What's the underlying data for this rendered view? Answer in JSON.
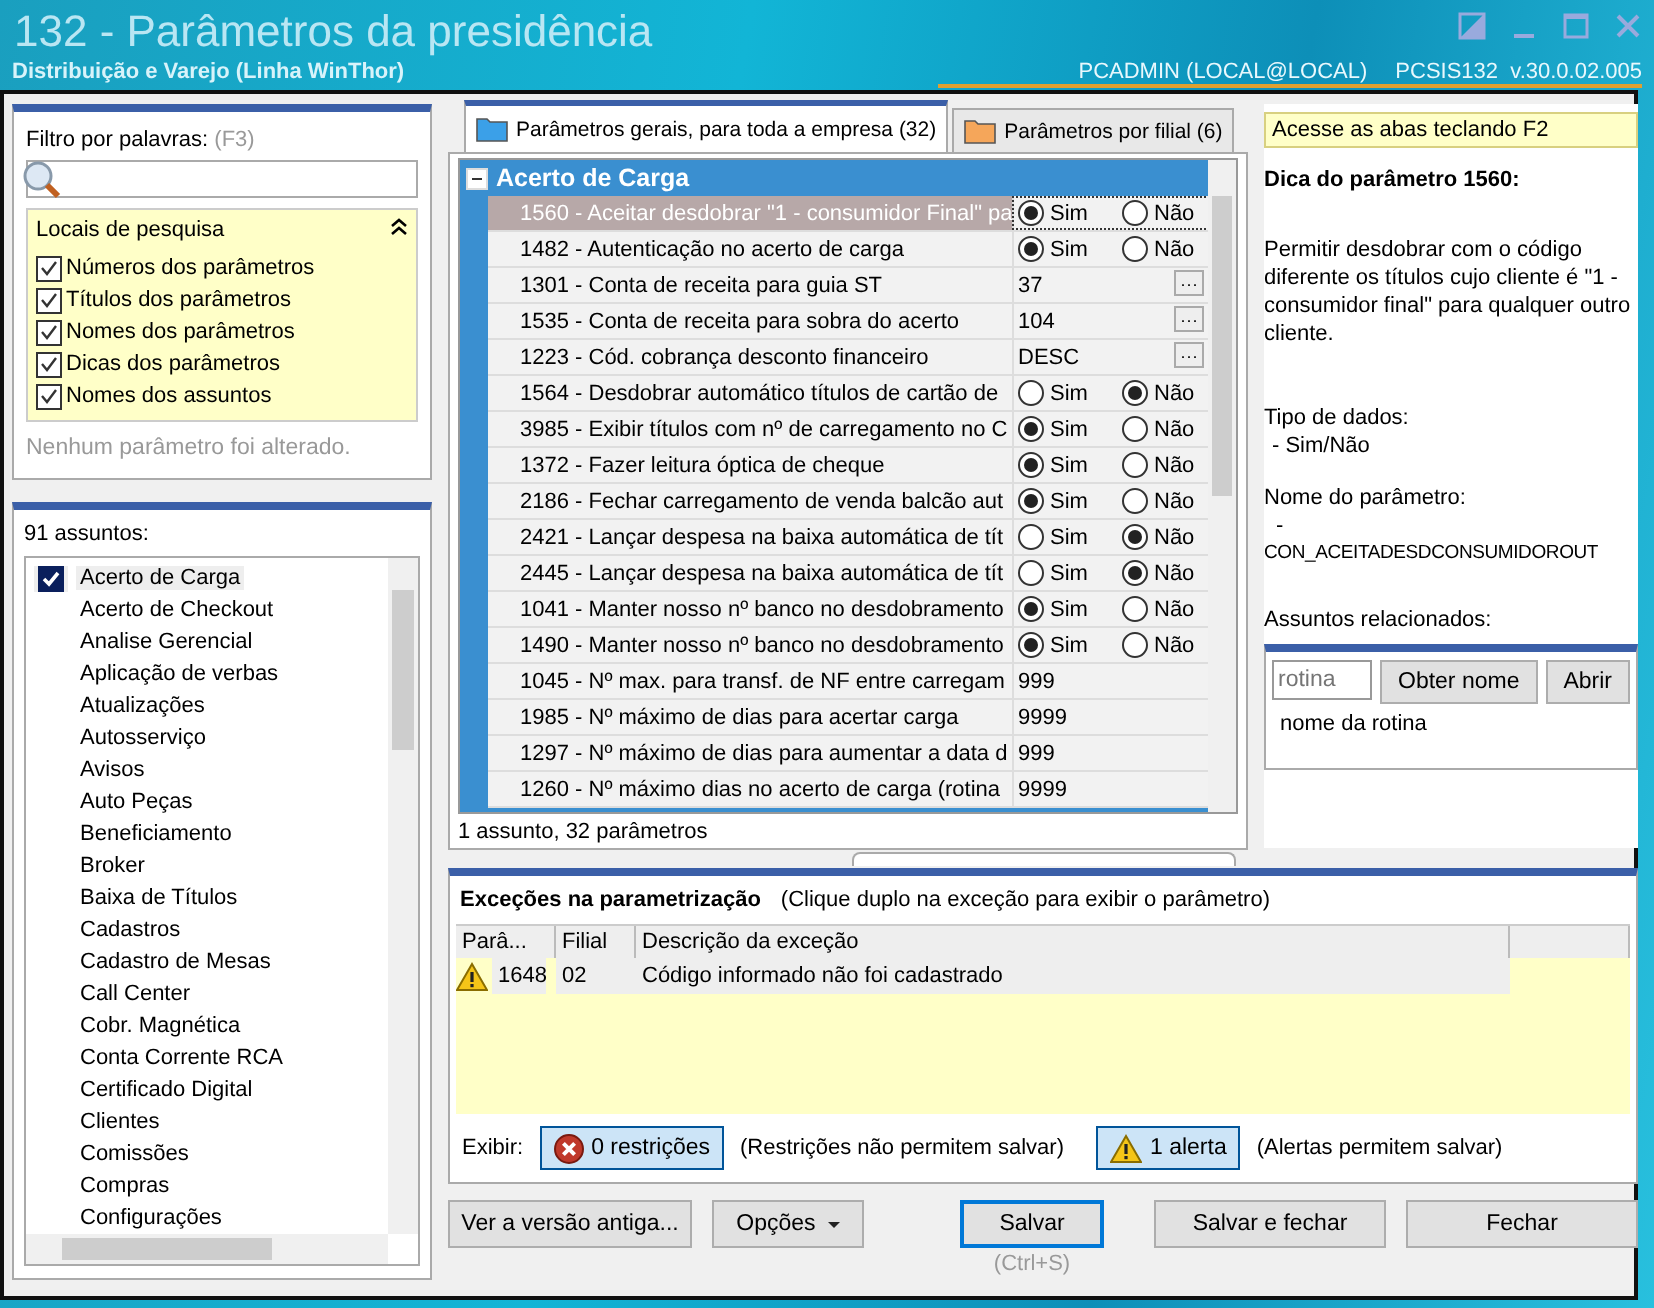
{
  "window": {
    "title": "132 - Parâmetros da presidência",
    "subtitle": "Distribuição e Varejo (Linha WinThor)",
    "user": "PCADMIN (LOCAL@LOCAL)",
    "program": "PCSIS132  v.30.0.02.005"
  },
  "filter": {
    "label": "Filtro por palavras:",
    "shortcut": "(F3)",
    "search_locations": {
      "title": "Locais de pesquisa",
      "expanded": true,
      "options": [
        {
          "label": "Números dos parâmetros",
          "checked": true
        },
        {
          "label": "Títulos dos parâmetros",
          "checked": true
        },
        {
          "label": "Nomes dos parâmetros",
          "checked": true
        },
        {
          "label": "Dicas dos parâmetros",
          "checked": true
        },
        {
          "label": "Nomes dos assuntos",
          "checked": true
        }
      ]
    },
    "status": "Nenhum parâmetro foi alterado."
  },
  "subjects": {
    "count_label": "91 assuntos:",
    "items": [
      {
        "label": "Acerto de Carga",
        "checked": true
      },
      {
        "label": "Acerto de Checkout",
        "checked": false
      },
      {
        "label": "Analise Gerencial",
        "checked": false
      },
      {
        "label": "Aplicação de verbas",
        "checked": false
      },
      {
        "label": "Atualizações",
        "checked": false
      },
      {
        "label": "Autosserviço",
        "checked": false
      },
      {
        "label": "Avisos",
        "checked": false
      },
      {
        "label": "Auto Peças",
        "checked": false
      },
      {
        "label": "Beneficiamento",
        "checked": false
      },
      {
        "label": "Broker",
        "checked": false
      },
      {
        "label": "Baixa de Títulos",
        "checked": false
      },
      {
        "label": "Cadastros",
        "checked": false
      },
      {
        "label": "Cadastro de Mesas",
        "checked": false
      },
      {
        "label": "Call Center",
        "checked": false
      },
      {
        "label": "Cobr. Magnética",
        "checked": false
      },
      {
        "label": "Conta Corrente RCA",
        "checked": false
      },
      {
        "label": "Certificado Digital",
        "checked": false
      },
      {
        "label": "Clientes",
        "checked": false
      },
      {
        "label": "Comissões",
        "checked": false
      },
      {
        "label": "Compras",
        "checked": false
      },
      {
        "label": "Configurações",
        "checked": false
      }
    ]
  },
  "tabs": [
    {
      "label": "Parâmetros gerais, para toda a empresa",
      "count": "(32)",
      "selected": true
    },
    {
      "label": "Parâmetros por filial",
      "count": "(6)",
      "selected": false
    }
  ],
  "grid": {
    "group": "Acerto de Carga",
    "expanded": true,
    "rows": [
      {
        "label": "1560 - Aceitar desdobrar \"1 - consumidor Final\" pa",
        "kind": "choice",
        "selected": true,
        "options": [
          {
            "label": "Sim",
            "selected": true
          },
          {
            "label": "Não",
            "selected": false
          }
        ]
      },
      {
        "label": "1482 - Autenticação no acerto de carga",
        "kind": "choice",
        "selected": false,
        "options": [
          {
            "label": "Sim",
            "selected": true
          },
          {
            "label": "Não",
            "selected": false
          }
        ]
      },
      {
        "label": "1301 - Conta de receita para guia ST",
        "kind": "lookup",
        "selected": false,
        "value": "37",
        "button": "···"
      },
      {
        "label": "1535 - Conta de receita para sobra do acerto",
        "kind": "lookup",
        "selected": false,
        "value": "104",
        "button": "···"
      },
      {
        "label": "1223 - Cód. cobrança desconto financeiro",
        "kind": "lookup",
        "selected": false,
        "value": "DESC",
        "button": "···"
      },
      {
        "label": "1564 - Desdobrar automático títulos de cartão de",
        "kind": "choice",
        "selected": false,
        "options": [
          {
            "label": "Sim",
            "selected": false
          },
          {
            "label": "Não",
            "selected": true
          }
        ]
      },
      {
        "label": "3985 - Exibir títulos com nº de carregamento no C",
        "kind": "choice",
        "selected": false,
        "options": [
          {
            "label": "Sim",
            "selected": true
          },
          {
            "label": "Não",
            "selected": false
          }
        ]
      },
      {
        "label": "1372 - Fazer leitura óptica de cheque",
        "kind": "choice",
        "selected": false,
        "options": [
          {
            "label": "Sim",
            "selected": true
          },
          {
            "label": "Não",
            "selected": false
          }
        ]
      },
      {
        "label": "2186 - Fechar carregamento de venda balcão aut",
        "kind": "choice",
        "selected": false,
        "options": [
          {
            "label": "Sim",
            "selected": true
          },
          {
            "label": "Não",
            "selected": false
          }
        ]
      },
      {
        "label": "2421 - Lançar despesa na baixa automática de tít",
        "kind": "choice",
        "selected": false,
        "options": [
          {
            "label": "Sim",
            "selected": false
          },
          {
            "label": "Não",
            "selected": true
          }
        ]
      },
      {
        "label": "2445 - Lançar despesa na baixa automática de tít",
        "kind": "choice",
        "selected": false,
        "options": [
          {
            "label": "Sim",
            "selected": false
          },
          {
            "label": "Não",
            "selected": true
          }
        ]
      },
      {
        "label": "1041 - Manter nosso nº banco no desdobramento",
        "kind": "choice",
        "selected": false,
        "options": [
          {
            "label": "Sim",
            "selected": true
          },
          {
            "label": "Não",
            "selected": false
          }
        ]
      },
      {
        "label": "1490 - Manter nosso nº banco no desdobramento",
        "kind": "choice",
        "selected": false,
        "options": [
          {
            "label": "Sim",
            "selected": true
          },
          {
            "label": "Não",
            "selected": false
          }
        ]
      },
      {
        "label": "1045 - Nº max. para transf. de NF entre carregam",
        "kind": "text",
        "selected": false,
        "value": "999"
      },
      {
        "label": "1985 - Nº máximo de dias para acertar carga",
        "kind": "text",
        "selected": false,
        "value": "9999"
      },
      {
        "label": "1297 - Nº máximo de dias para aumentar a data d",
        "kind": "text",
        "selected": false,
        "value": "999"
      },
      {
        "label": "1260 - Nº máximo dias no acerto de carga (rotina",
        "kind": "text",
        "selected": false,
        "value": "9999"
      }
    ],
    "footer": "1 assunto, 32 parâmetros"
  },
  "hint": {
    "banner": "Acesse as abas teclando F2",
    "title": "Dica do parâmetro 1560:",
    "description": "Permitir desdobrar com o código diferente os títulos cujo cliente é \"1 - consumidor final\" para qualquer outro cliente.",
    "data_type_label": "Tipo de dados:",
    "data_type": "- Sim/Não",
    "name_label": "Nome do parâmetro:",
    "name_dash": "-",
    "name": "CON_ACEITADESDCONSUMIDOROUT",
    "related_label": "Assuntos relacionados:",
    "routine_placeholder": "rotina",
    "get_name_button": "Obter nome",
    "open_button": "Abrir",
    "routine_name": "nome da rotina"
  },
  "exceptions": {
    "title": "Exceções na parametrização",
    "hint": "(Clique duplo na exceção para exibir o parâmetro)",
    "columns": [
      "Parâ...",
      "Filial",
      "Descrição da exceção"
    ],
    "rows": [
      {
        "kind": "alert",
        "param": "1648",
        "branch": "02",
        "description": "Código informado não foi cadastrado"
      }
    ],
    "show_label": "Exibir:",
    "filters": [
      {
        "kind": "restriction",
        "label": "0 restrições",
        "note": "(Restrições não permitem salvar)",
        "selected": true
      },
      {
        "kind": "alert",
        "label": "1 alerta",
        "note": "(Alertas permitem salvar)",
        "selected": true
      }
    ]
  },
  "buttons": [
    {
      "label": "Ver a versão antiga...",
      "kind": "plain"
    },
    {
      "label": "Opções",
      "kind": "menu"
    },
    {
      "label": "Salvar",
      "kind": "default",
      "shortcut": "(Ctrl+S)"
    },
    {
      "label": "Salvar e fechar",
      "kind": "plain"
    },
    {
      "label": "Fechar",
      "kind": "plain"
    }
  ]
}
